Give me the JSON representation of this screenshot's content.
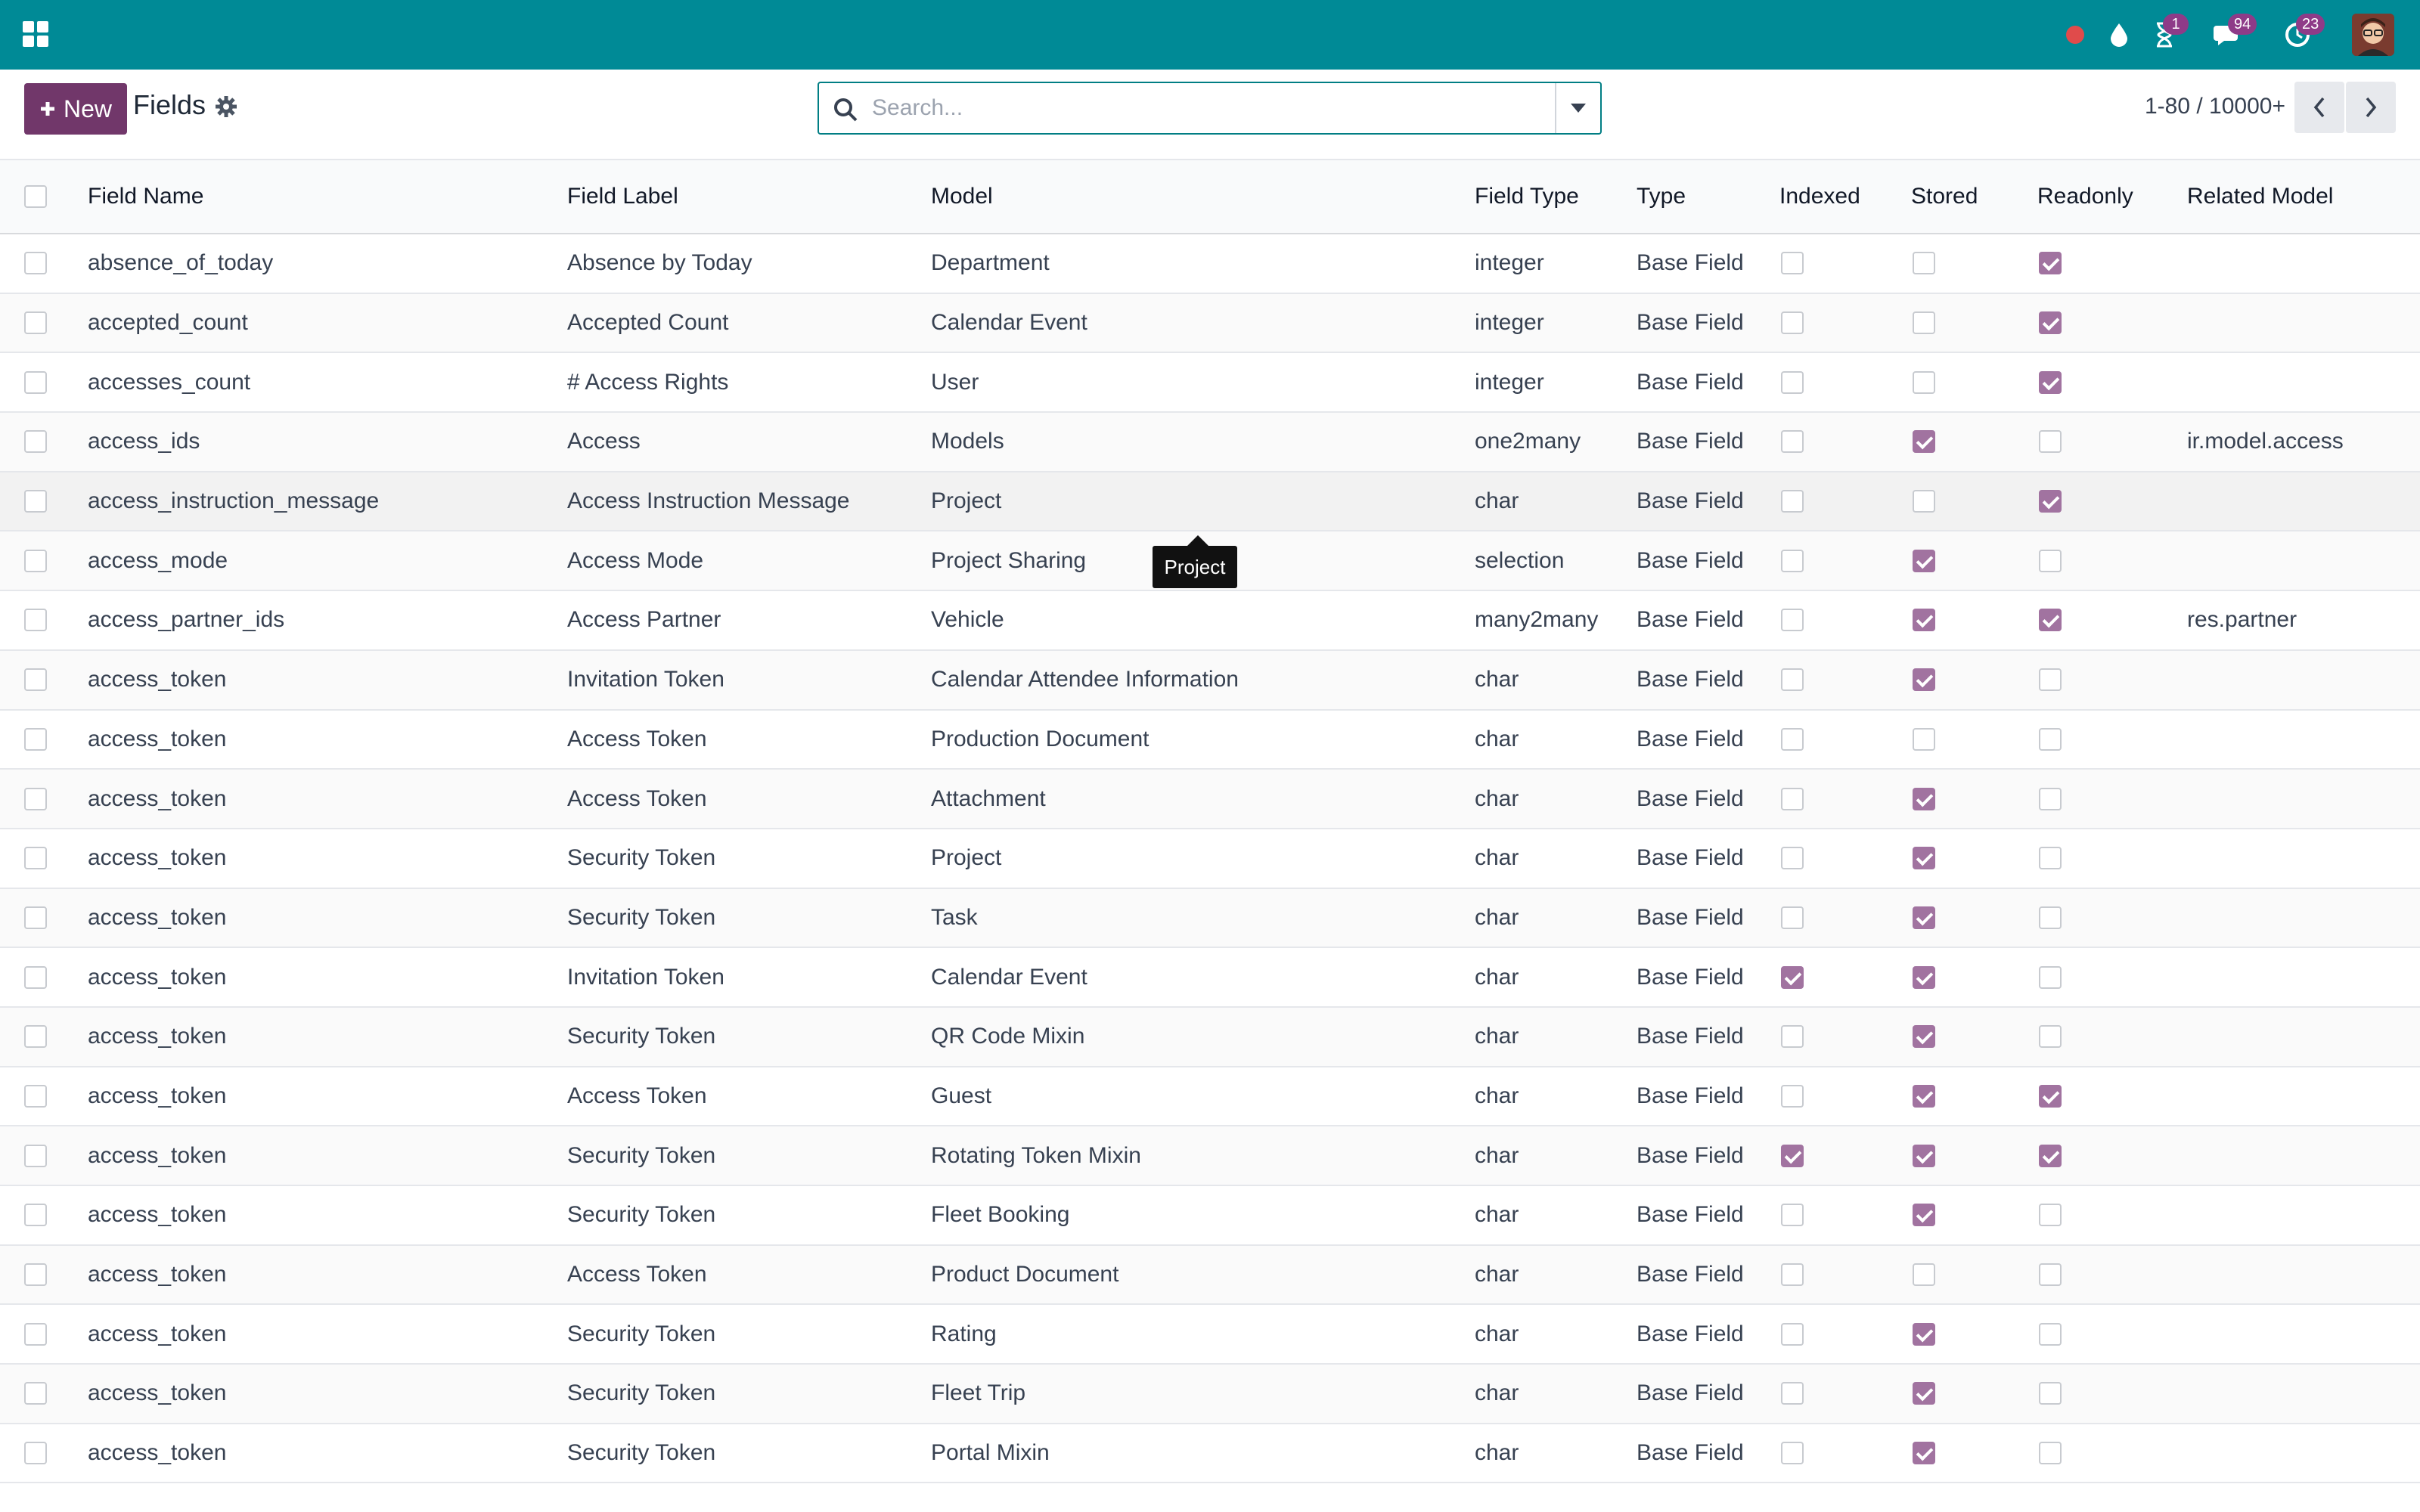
{
  "navbar": {
    "badges": {
      "activities": "1",
      "messages": "94",
      "timer": "23"
    },
    "colors": {
      "bar": "#008a96",
      "badge": "#8e3b88"
    }
  },
  "control": {
    "new_label": "New",
    "breadcrumb": "Fields",
    "search_placeholder": "Search...",
    "pager": "1-80 / 10000+"
  },
  "tooltip": "Project",
  "columns": [
    "Field Name",
    "Field Label",
    "Model",
    "Field Type",
    "Type",
    "Indexed",
    "Stored",
    "Readonly",
    "Related Model"
  ],
  "rows": [
    {
      "name": "absence_of_today",
      "label": "Absence by Today",
      "model": "Department",
      "ftype": "integer",
      "type": "Base Field",
      "indexed": false,
      "stored": false,
      "readonly": true,
      "related": ""
    },
    {
      "name": "accepted_count",
      "label": "Accepted Count",
      "model": "Calendar Event",
      "ftype": "integer",
      "type": "Base Field",
      "indexed": false,
      "stored": false,
      "readonly": true,
      "related": ""
    },
    {
      "name": "accesses_count",
      "label": "# Access Rights",
      "model": "User",
      "ftype": "integer",
      "type": "Base Field",
      "indexed": false,
      "stored": false,
      "readonly": true,
      "related": ""
    },
    {
      "name": "access_ids",
      "label": "Access",
      "model": "Models",
      "ftype": "one2many",
      "type": "Base Field",
      "indexed": false,
      "stored": true,
      "readonly": false,
      "related": "ir.model.access"
    },
    {
      "name": "access_instruction_message",
      "label": "Access Instruction Message",
      "model": "Project",
      "ftype": "char",
      "type": "Base Field",
      "indexed": false,
      "stored": false,
      "readonly": true,
      "related": ""
    },
    {
      "name": "access_mode",
      "label": "Access Mode",
      "model": "Project Sharing",
      "ftype": "selection",
      "type": "Base Field",
      "indexed": false,
      "stored": true,
      "readonly": false,
      "related": ""
    },
    {
      "name": "access_partner_ids",
      "label": "Access Partner",
      "model": "Vehicle",
      "ftype": "many2many",
      "type": "Base Field",
      "indexed": false,
      "stored": true,
      "readonly": true,
      "related": "res.partner"
    },
    {
      "name": "access_token",
      "label": "Invitation Token",
      "model": "Calendar Attendee Information",
      "ftype": "char",
      "type": "Base Field",
      "indexed": false,
      "stored": true,
      "readonly": false,
      "related": ""
    },
    {
      "name": "access_token",
      "label": "Access Token",
      "model": "Production Document",
      "ftype": "char",
      "type": "Base Field",
      "indexed": false,
      "stored": false,
      "readonly": false,
      "related": ""
    },
    {
      "name": "access_token",
      "label": "Access Token",
      "model": "Attachment",
      "ftype": "char",
      "type": "Base Field",
      "indexed": false,
      "stored": true,
      "readonly": false,
      "related": ""
    },
    {
      "name": "access_token",
      "label": "Security Token",
      "model": "Project",
      "ftype": "char",
      "type": "Base Field",
      "indexed": false,
      "stored": true,
      "readonly": false,
      "related": ""
    },
    {
      "name": "access_token",
      "label": "Security Token",
      "model": "Task",
      "ftype": "char",
      "type": "Base Field",
      "indexed": false,
      "stored": true,
      "readonly": false,
      "related": ""
    },
    {
      "name": "access_token",
      "label": "Invitation Token",
      "model": "Calendar Event",
      "ftype": "char",
      "type": "Base Field",
      "indexed": true,
      "stored": true,
      "readonly": false,
      "related": ""
    },
    {
      "name": "access_token",
      "label": "Security Token",
      "model": "QR Code Mixin",
      "ftype": "char",
      "type": "Base Field",
      "indexed": false,
      "stored": true,
      "readonly": false,
      "related": ""
    },
    {
      "name": "access_token",
      "label": "Access Token",
      "model": "Guest",
      "ftype": "char",
      "type": "Base Field",
      "indexed": false,
      "stored": true,
      "readonly": true,
      "related": ""
    },
    {
      "name": "access_token",
      "label": "Security Token",
      "model": "Rotating Token Mixin",
      "ftype": "char",
      "type": "Base Field",
      "indexed": true,
      "stored": true,
      "readonly": true,
      "related": ""
    },
    {
      "name": "access_token",
      "label": "Security Token",
      "model": "Fleet Booking",
      "ftype": "char",
      "type": "Base Field",
      "indexed": false,
      "stored": true,
      "readonly": false,
      "related": ""
    },
    {
      "name": "access_token",
      "label": "Access Token",
      "model": "Product Document",
      "ftype": "char",
      "type": "Base Field",
      "indexed": false,
      "stored": false,
      "readonly": false,
      "related": ""
    },
    {
      "name": "access_token",
      "label": "Security Token",
      "model": "Rating",
      "ftype": "char",
      "type": "Base Field",
      "indexed": false,
      "stored": true,
      "readonly": false,
      "related": ""
    },
    {
      "name": "access_token",
      "label": "Security Token",
      "model": "Fleet Trip",
      "ftype": "char",
      "type": "Base Field",
      "indexed": false,
      "stored": true,
      "readonly": false,
      "related": ""
    },
    {
      "name": "access_token",
      "label": "Security Token",
      "model": "Portal Mixin",
      "ftype": "char",
      "type": "Base Field",
      "indexed": false,
      "stored": true,
      "readonly": false,
      "related": ""
    }
  ]
}
